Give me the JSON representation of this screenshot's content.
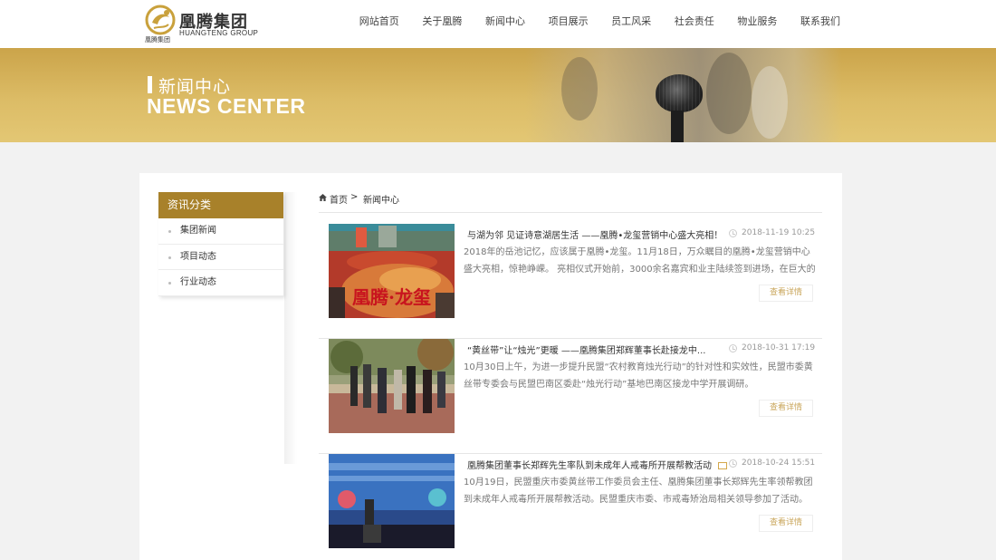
{
  "brand": {
    "name_cn": "凰腾集团",
    "name_en": "HUANGTENG GROUP",
    "name_small": "凰腾集团",
    "gold": "#a8812a",
    "banner_gold": "#dcbc66"
  },
  "nav": {
    "items": [
      "网站首页",
      "关于凰腾",
      "新闻中心",
      "项目展示",
      "员工风采",
      "社会责任",
      "物业服务",
      "联系我们"
    ]
  },
  "banner": {
    "title_cn": "新闻中心",
    "title_en": "NEWS CENTER"
  },
  "sidebar": {
    "heading": "资讯分类",
    "items": [
      "集团新闻",
      "项目动态",
      "行业动态"
    ]
  },
  "breadcrumb": {
    "home": "首页",
    "separator": ">",
    "current": "新闻中心",
    "home_icon": "home-icon"
  },
  "news": [
    {
      "title": "与湖为邻 见证诗意湖居生活 ——凰腾•龙玺营销中心盛大亮相！",
      "date": "2018-11-19 10:25",
      "desc": "2018年的岳池记忆，应该属于凰腾•龙玺。11月18日，万众瞩目的凰腾•龙玺营销中心盛大亮相，惊艳峥嵘。 亮相仪式开始前，3000余名嘉宾和业主陆续签到进场，在巨大的画...",
      "more": "查看详情",
      "thumb_text": "凰腾·龙玺"
    },
    {
      "title": "“黄丝带”让“烛光”更暖 ——凰腾集团郑辉董事长赴接龙中...",
      "date": "2018-10-31 17:19",
      "desc": "10月30日上午，为进一步提升民盟“农村教育烛光行动”的针对性和实效性，民盟市委黄丝带专委会与民盟巴南区委赴“烛光行动”基地巴南区接龙中学开展调研。",
      "more": "查看详情"
    },
    {
      "title": "凰腾集团董事长郑辉先生率队到未成年人戒毒所开展帮教活动",
      "date": "2018-10-24 15:51",
      "desc": "10月19日，民盟重庆市委黄丝带工作委员会主任、凰腾集团董事长郑辉先生率领帮教团到未成年人戒毒所开展帮教活动。民盟重庆市委、市戒毒矫治局相关领导参加了活动。郑...",
      "more": "查看详情",
      "has_image_icon": true
    }
  ]
}
